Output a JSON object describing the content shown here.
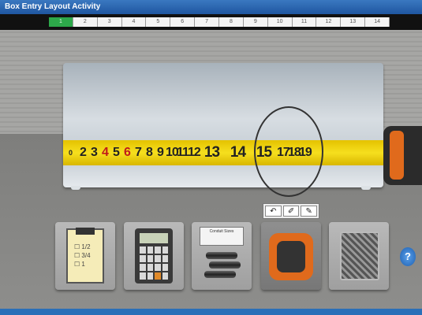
{
  "app": {
    "title": "Box Entry Layout Activity"
  },
  "progress": {
    "active_index": 0,
    "steps": [
      "1",
      "2",
      "3",
      "4",
      "5",
      "6",
      "7",
      "8",
      "9",
      "10",
      "11",
      "12",
      "13",
      "14"
    ]
  },
  "tape_measure": {
    "end_label": "0",
    "inches": [
      "2",
      "3",
      "4",
      "5",
      "6",
      "7",
      "8",
      "9",
      "10",
      "11",
      "12"
    ],
    "zoomed_inches": [
      "13",
      "14",
      "15"
    ],
    "tail_inches": [
      "17",
      "18",
      "19"
    ]
  },
  "tools_mini": {
    "items": [
      "↶",
      "✐",
      "✎"
    ]
  },
  "tool_cards": [
    {
      "name": "checklist",
      "lines": [
        "☐ 1/2",
        "☐ 3/4",
        "☐ 1"
      ]
    },
    {
      "name": "calculator"
    },
    {
      "name": "conduit",
      "label": "Conduit Sizes"
    },
    {
      "name": "tape-measure"
    },
    {
      "name": "fittings-bag"
    }
  ],
  "help": {
    "label": "?"
  },
  "colors": {
    "accent": "#2a6fb8",
    "progress_active": "#2da84a",
    "tape": "#f6df1e"
  }
}
